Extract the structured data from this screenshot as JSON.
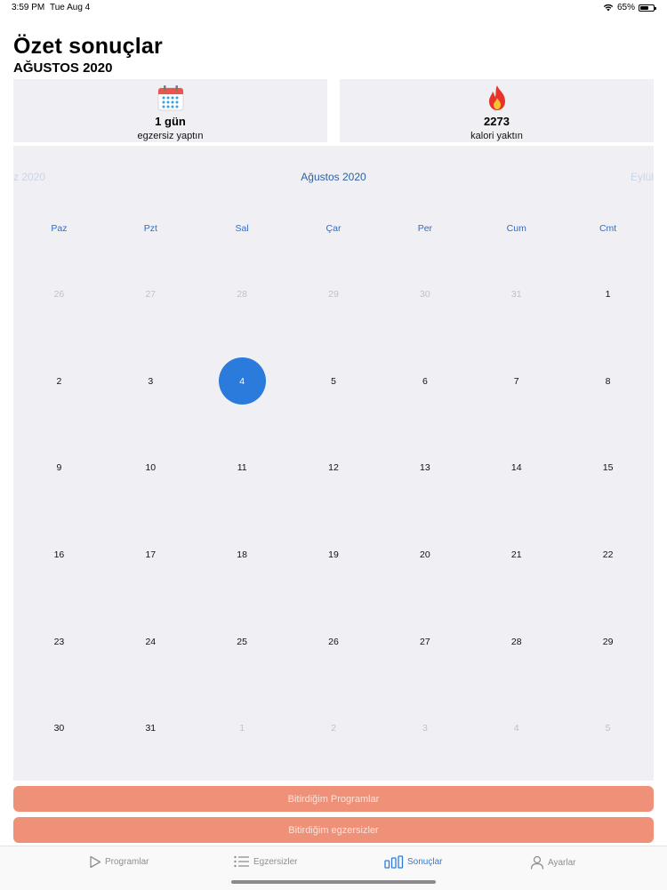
{
  "status_bar": {
    "time": "3:59 PM",
    "date": "Tue Aug 4",
    "battery": "65%",
    "battery_level": 0.65
  },
  "header": {
    "title": "Özet sonuçlar",
    "subtitle": "AĞUSTOS 2020"
  },
  "stats": {
    "days": {
      "icon": "calendar-icon",
      "value": "1 gün",
      "label": "egzersiz yaptın"
    },
    "calories": {
      "icon": "flame-icon",
      "value": "2273",
      "label": "kalori yaktın"
    }
  },
  "calendar": {
    "prev_month": "z 2020",
    "current_month": "Ağustos 2020",
    "next_month": "Eylül",
    "weekdays": [
      "Paz",
      "Pzt",
      "Sal",
      "Çar",
      "Per",
      "Cum",
      "Cmt"
    ],
    "selected_day": "4",
    "weeks": [
      [
        {
          "d": "26",
          "m": true
        },
        {
          "d": "27",
          "m": true
        },
        {
          "d": "28",
          "m": true
        },
        {
          "d": "29",
          "m": true
        },
        {
          "d": "30",
          "m": true
        },
        {
          "d": "31",
          "m": true
        },
        {
          "d": "1",
          "m": false
        }
      ],
      [
        {
          "d": "2",
          "m": false
        },
        {
          "d": "3",
          "m": false
        },
        {
          "d": "4",
          "m": false
        },
        {
          "d": "5",
          "m": false
        },
        {
          "d": "6",
          "m": false
        },
        {
          "d": "7",
          "m": false
        },
        {
          "d": "8",
          "m": false
        }
      ],
      [
        {
          "d": "9",
          "m": false
        },
        {
          "d": "10",
          "m": false
        },
        {
          "d": "11",
          "m": false
        },
        {
          "d": "12",
          "m": false
        },
        {
          "d": "13",
          "m": false
        },
        {
          "d": "14",
          "m": false
        },
        {
          "d": "15",
          "m": false
        }
      ],
      [
        {
          "d": "16",
          "m": false
        },
        {
          "d": "17",
          "m": false
        },
        {
          "d": "18",
          "m": false
        },
        {
          "d": "19",
          "m": false
        },
        {
          "d": "20",
          "m": false
        },
        {
          "d": "21",
          "m": false
        },
        {
          "d": "22",
          "m": false
        }
      ],
      [
        {
          "d": "23",
          "m": false
        },
        {
          "d": "24",
          "m": false
        },
        {
          "d": "25",
          "m": false
        },
        {
          "d": "26",
          "m": false
        },
        {
          "d": "27",
          "m": false
        },
        {
          "d": "28",
          "m": false
        },
        {
          "d": "29",
          "m": false
        }
      ],
      [
        {
          "d": "30",
          "m": false
        },
        {
          "d": "31",
          "m": false
        },
        {
          "d": "1",
          "m": true
        },
        {
          "d": "2",
          "m": true
        },
        {
          "d": "3",
          "m": true
        },
        {
          "d": "4",
          "m": true
        },
        {
          "d": "5",
          "m": true
        }
      ]
    ]
  },
  "actions": {
    "completed_programs": "Bitirdiğim Programlar",
    "completed_exercises": "Bitirdiğim egzersizler"
  },
  "tab_bar": {
    "programs": {
      "label": "Programlar",
      "icon": "play-icon"
    },
    "exercises": {
      "label": "Egzersizler",
      "icon": "list-icon"
    },
    "results": {
      "label": "Sonuçlar",
      "icon": "bar-chart-icon",
      "active": true
    },
    "settings": {
      "label": "Ayarlar",
      "icon": "person-icon"
    }
  },
  "colors": {
    "accent": "#2a7bdb",
    "button": "#ef9178",
    "card_bg": "#f0f0f4"
  }
}
